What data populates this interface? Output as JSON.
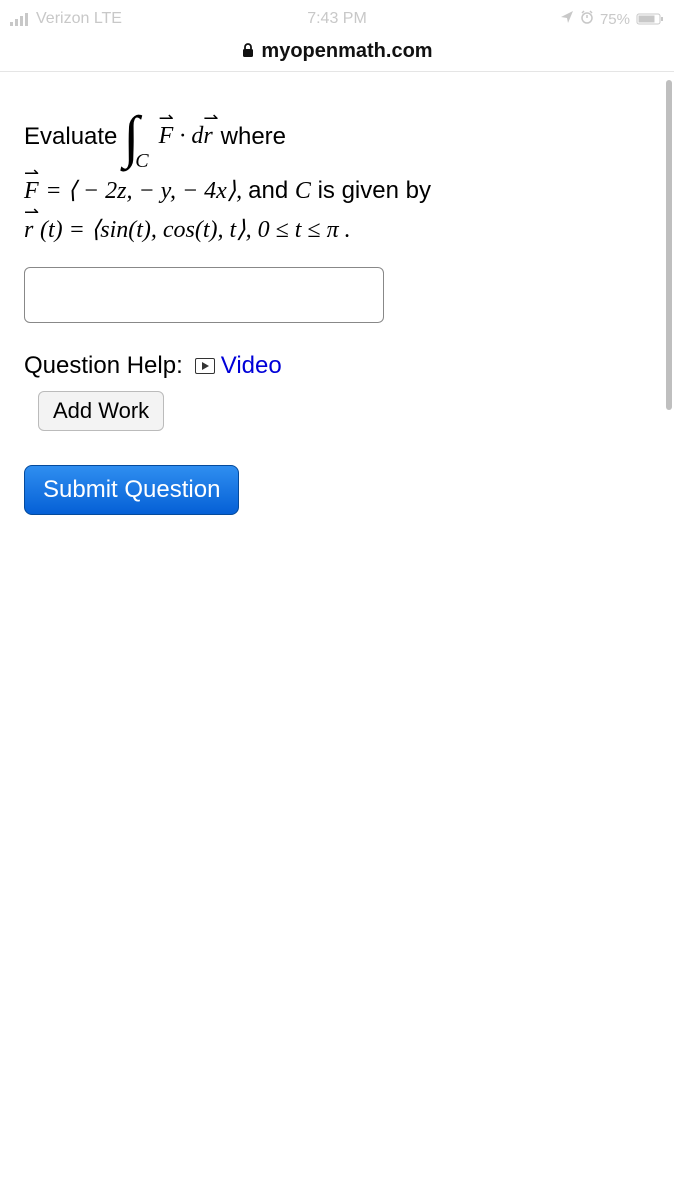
{
  "statusbar": {
    "carrier": "Verizon  LTE",
    "time": "7:43 PM",
    "battery_pct": "75%"
  },
  "browser": {
    "url": "myopenmath.com"
  },
  "question": {
    "evaluate_label": "Evaluate",
    "integral_sub": "C",
    "integrand_F": "F",
    "dot": "·",
    "dr_d": "d",
    "dr_r": "r",
    "where": "where",
    "line2_pre": "F",
    "line2_eq": " = ⟨ − 2z,  − y,  − 4x⟩, ",
    "line2_and": "and ",
    "line2_C": "C",
    "line2_given": " is given by",
    "line3_r": "r",
    "line3_rest": "(t) = ⟨sin(t), cos(t), t⟩,  0 ≤ t ≤ π ."
  },
  "help": {
    "label": "Question Help:",
    "video": "Video",
    "addwork": "Add Work"
  },
  "buttons": {
    "submit": "Submit Question"
  }
}
